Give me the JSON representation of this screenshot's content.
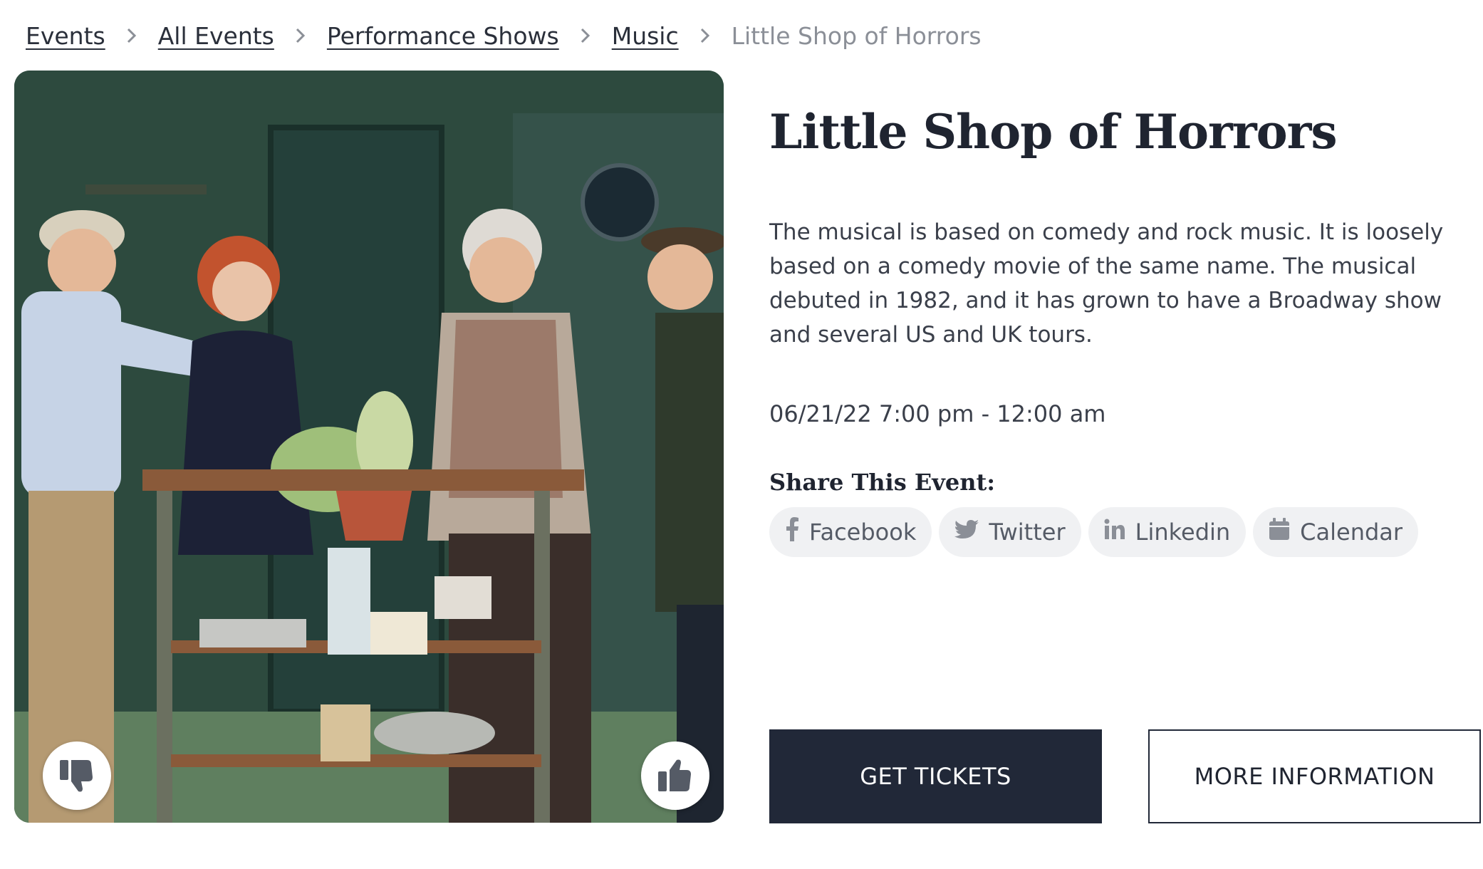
{
  "breadcrumb": {
    "items": [
      {
        "label": "Events"
      },
      {
        "label": "All Events"
      },
      {
        "label": "Performance Shows"
      },
      {
        "label": "Music"
      }
    ],
    "current": "Little Shop of Horrors"
  },
  "event": {
    "title": "Little Shop of Horrors",
    "description": "The musical is based on comedy and rock music. It is loosely based on a comedy movie of the same name. The musical debuted in 1982, and it has grown to have a Broadway show and several US and UK tours.",
    "datetime": "06/21/22 7:00 pm - 12:00 am"
  },
  "share": {
    "title": "Share This Event:",
    "buttons": [
      {
        "label": "Facebook",
        "icon": "facebook-icon"
      },
      {
        "label": "Twitter",
        "icon": "twitter-icon"
      },
      {
        "label": "Linkedin",
        "icon": "linkedin-icon"
      },
      {
        "label": "Calendar",
        "icon": "calendar-icon"
      }
    ]
  },
  "actions": {
    "get_tickets": "GET TICKETS",
    "more_info": "MORE INFORMATION"
  },
  "image": {
    "vote_down_icon": "thumbs-down-icon",
    "vote_up_icon": "thumbs-up-icon"
  },
  "colors": {
    "primary_dark": "#212838",
    "muted_text": "#8b8f97",
    "pill_bg": "#f0f1f3"
  }
}
